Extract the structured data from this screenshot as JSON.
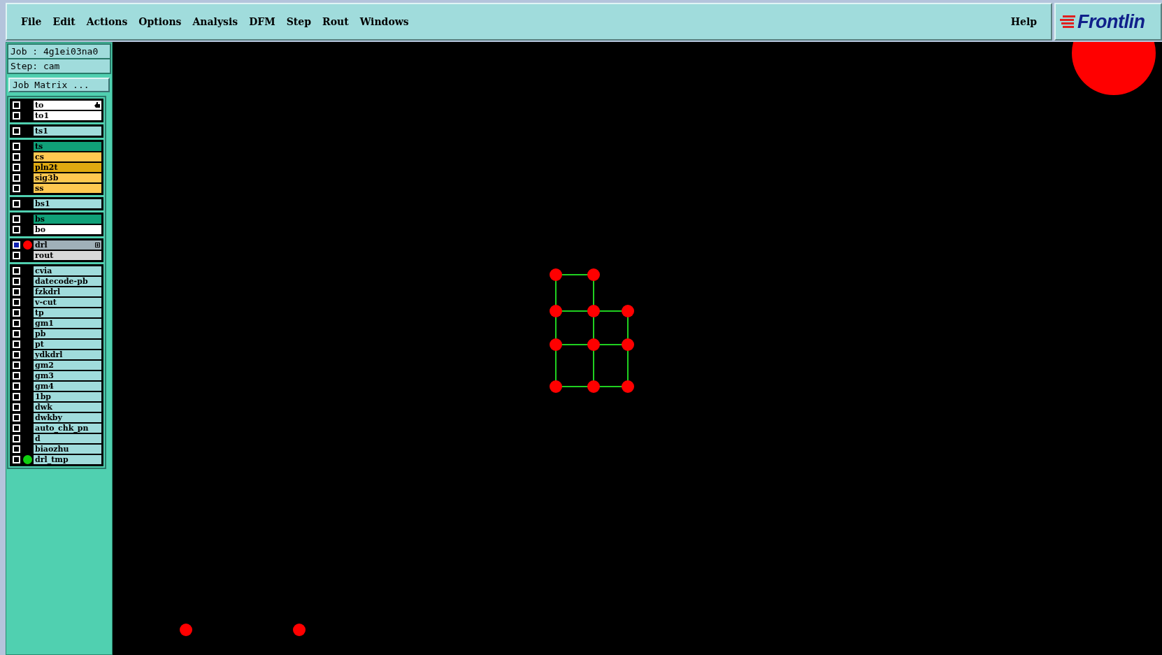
{
  "menu": [
    {
      "label": "File"
    },
    {
      "label": "Edit"
    },
    {
      "label": "Actions"
    },
    {
      "label": "Options"
    },
    {
      "label": "Analysis"
    },
    {
      "label": "DFM"
    },
    {
      "label": "Step"
    },
    {
      "label": "Rout"
    },
    {
      "label": "Windows"
    }
  ],
  "help": {
    "label": "Help"
  },
  "logo": {
    "text": "Frontlin"
  },
  "job_info": {
    "job": "Job : 4g1ei03na0",
    "step": "Step: cam"
  },
  "job_matrix_button": {
    "label": "Job Matrix ..."
  },
  "layer_groups": [
    {
      "layers": [
        {
          "name": "to",
          "color": "#ffffff",
          "checked": false,
          "affected": false,
          "work": true,
          "sub": false
        },
        {
          "name": "to1",
          "color": "#ffffff",
          "checked": false,
          "affected": false,
          "work": false,
          "sub": false
        }
      ]
    },
    {
      "layers": [
        {
          "name": "ts1",
          "color": "#a0dcdc",
          "checked": false,
          "affected": false,
          "work": false,
          "sub": false
        }
      ]
    },
    {
      "layers": [
        {
          "name": "ts",
          "color": "#10a078",
          "checked": false,
          "affected": false,
          "work": false,
          "sub": false
        },
        {
          "name": "cs",
          "color": "#ffc850",
          "checked": false,
          "affected": false,
          "work": false,
          "sub": false
        },
        {
          "name": "pln2t",
          "color": "#e0aa10",
          "checked": false,
          "affected": false,
          "work": false,
          "sub": false
        },
        {
          "name": "sig3b",
          "color": "#ffc850",
          "checked": false,
          "affected": false,
          "work": false,
          "sub": false
        },
        {
          "name": "ss",
          "color": "#ffc850",
          "checked": false,
          "affected": false,
          "work": false,
          "sub": false
        }
      ]
    },
    {
      "layers": [
        {
          "name": "bs1",
          "color": "#a0dcdc",
          "checked": false,
          "affected": false,
          "work": false,
          "sub": false
        }
      ]
    },
    {
      "layers": [
        {
          "name": "bs",
          "color": "#10a078",
          "checked": false,
          "affected": false,
          "work": false,
          "sub": false
        },
        {
          "name": "bo",
          "color": "#ffffff",
          "checked": false,
          "affected": false,
          "work": false,
          "sub": false
        }
      ]
    },
    {
      "layers": [
        {
          "name": "drl",
          "color": "#a0b0b8",
          "checked": false,
          "affected": true,
          "work": false,
          "sub": true,
          "dot": {
            "color": "#ff0000"
          }
        },
        {
          "name": "rout",
          "color": "#d8d8d8",
          "checked": false,
          "affected": false,
          "work": false,
          "sub": false
        }
      ]
    },
    {
      "layers": [
        {
          "name": "cvia",
          "color": "#a0dcdc",
          "checked": false,
          "affected": false,
          "work": false,
          "sub": false
        },
        {
          "name": "datecode-pb",
          "color": "#a0dcdc",
          "checked": false,
          "affected": false,
          "work": false,
          "sub": false
        },
        {
          "name": "fzkdrl",
          "color": "#a0dcdc",
          "checked": false,
          "affected": false,
          "work": false,
          "sub": false
        },
        {
          "name": "v-cut",
          "color": "#a0dcdc",
          "checked": false,
          "affected": false,
          "work": false,
          "sub": false
        },
        {
          "name": "tp",
          "color": "#a0dcdc",
          "checked": false,
          "affected": false,
          "work": false,
          "sub": false
        },
        {
          "name": "gm1",
          "color": "#a0dcdc",
          "checked": false,
          "affected": false,
          "work": false,
          "sub": false
        },
        {
          "name": "pb",
          "color": "#a0dcdc",
          "checked": false,
          "affected": false,
          "work": false,
          "sub": false
        },
        {
          "name": "pt",
          "color": "#a0dcdc",
          "checked": false,
          "affected": false,
          "work": false,
          "sub": false
        },
        {
          "name": "ydkdrl",
          "color": "#a0dcdc",
          "checked": false,
          "affected": false,
          "work": false,
          "sub": false
        },
        {
          "name": "gm2",
          "color": "#a0dcdc",
          "checked": false,
          "affected": false,
          "work": false,
          "sub": false
        },
        {
          "name": "gm3",
          "color": "#a0dcdc",
          "checked": false,
          "affected": false,
          "work": false,
          "sub": false
        },
        {
          "name": "gm4",
          "color": "#a0dcdc",
          "checked": false,
          "affected": false,
          "work": false,
          "sub": false
        },
        {
          "name": "1bp",
          "color": "#a0dcdc",
          "checked": false,
          "affected": false,
          "work": false,
          "sub": false
        },
        {
          "name": "dwk",
          "color": "#a0dcdc",
          "checked": false,
          "affected": false,
          "work": false,
          "sub": false
        },
        {
          "name": "dwkby",
          "color": "#a0dcdc",
          "checked": false,
          "affected": false,
          "work": false,
          "sub": false
        },
        {
          "name": "auto_chk_pn",
          "color": "#a0dcdc",
          "checked": false,
          "affected": false,
          "work": false,
          "sub": false
        },
        {
          "name": "d",
          "color": "#a0dcdc",
          "checked": false,
          "affected": false,
          "work": false,
          "sub": false
        },
        {
          "name": "biaozhu",
          "color": "#a0dcdc",
          "checked": false,
          "affected": false,
          "work": false,
          "sub": false
        },
        {
          "name": "drl_tmp",
          "color": "#a0dcdc",
          "checked": false,
          "affected": false,
          "work": false,
          "sub": false,
          "dot": {
            "color": "#10d010"
          }
        }
      ]
    }
  ]
}
